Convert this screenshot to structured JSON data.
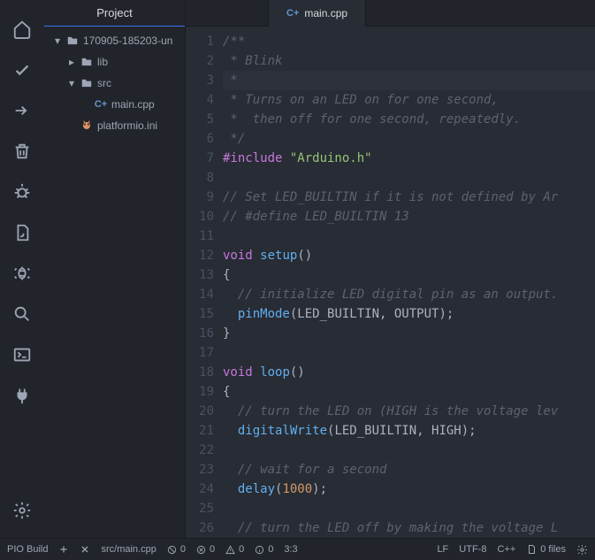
{
  "tree": {
    "title": "Project",
    "root": "170905-185203-un",
    "lib": "lib",
    "src": "src",
    "main": "main.cpp",
    "ini": "platformio.ini"
  },
  "tab": {
    "file": "main.cpp",
    "glyph": "C+"
  },
  "icons": {
    "cpp_glyph": "C+"
  },
  "code": [
    {
      "n": 1,
      "seg": [
        {
          "c": "com",
          "t": "/**"
        }
      ]
    },
    {
      "n": 2,
      "seg": [
        {
          "c": "com",
          "t": " * Blink"
        }
      ]
    },
    {
      "n": 3,
      "hl": true,
      "seg": [
        {
          "c": "com",
          "t": " *"
        }
      ]
    },
    {
      "n": 4,
      "seg": [
        {
          "c": "com",
          "t": " * Turns on an LED on for one second,"
        }
      ]
    },
    {
      "n": 5,
      "seg": [
        {
          "c": "com",
          "t": " *  then off for one second, repeatedly."
        }
      ]
    },
    {
      "n": 6,
      "seg": [
        {
          "c": "com",
          "t": " */"
        }
      ]
    },
    {
      "n": 7,
      "seg": [
        {
          "c": "pp",
          "t": "#include "
        },
        {
          "c": "str",
          "t": "\"Arduino.h\""
        }
      ]
    },
    {
      "n": 8,
      "seg": []
    },
    {
      "n": 9,
      "seg": [
        {
          "c": "com",
          "t": "// Set LED_BUILTIN if it is not defined by Ar"
        }
      ]
    },
    {
      "n": 10,
      "seg": [
        {
          "c": "com",
          "t": "// #define LED_BUILTIN 13"
        }
      ]
    },
    {
      "n": 11,
      "seg": []
    },
    {
      "n": 12,
      "seg": [
        {
          "c": "kw",
          "t": "void"
        },
        {
          "t": " "
        },
        {
          "c": "fn",
          "t": "setup"
        },
        {
          "t": "()"
        }
      ]
    },
    {
      "n": 13,
      "seg": [
        {
          "t": "{"
        }
      ]
    },
    {
      "n": 14,
      "seg": [
        {
          "t": "  "
        },
        {
          "c": "com",
          "t": "// initialize LED digital pin as an output."
        }
      ]
    },
    {
      "n": 15,
      "seg": [
        {
          "t": "  "
        },
        {
          "c": "fn",
          "t": "pinMode"
        },
        {
          "t": "(LED_BUILTIN, OUTPUT);"
        }
      ]
    },
    {
      "n": 16,
      "seg": [
        {
          "t": "}"
        }
      ]
    },
    {
      "n": 17,
      "seg": []
    },
    {
      "n": 18,
      "seg": [
        {
          "c": "kw",
          "t": "void"
        },
        {
          "t": " "
        },
        {
          "c": "fn",
          "t": "loop"
        },
        {
          "t": "()"
        }
      ]
    },
    {
      "n": 19,
      "seg": [
        {
          "t": "{"
        }
      ]
    },
    {
      "n": 20,
      "seg": [
        {
          "t": "  "
        },
        {
          "c": "com",
          "t": "// turn the LED on (HIGH is the voltage lev"
        }
      ]
    },
    {
      "n": 21,
      "seg": [
        {
          "t": "  "
        },
        {
          "c": "fn",
          "t": "digitalWrite"
        },
        {
          "t": "(LED_BUILTIN, HIGH);"
        }
      ]
    },
    {
      "n": 22,
      "seg": []
    },
    {
      "n": 23,
      "seg": [
        {
          "t": "  "
        },
        {
          "c": "com",
          "t": "// wait for a second"
        }
      ]
    },
    {
      "n": 24,
      "seg": [
        {
          "t": "  "
        },
        {
          "c": "fn",
          "t": "delay"
        },
        {
          "t": "("
        },
        {
          "c": "num",
          "t": "1000"
        },
        {
          "t": ");"
        }
      ]
    },
    {
      "n": 25,
      "seg": []
    },
    {
      "n": 26,
      "seg": [
        {
          "t": "  "
        },
        {
          "c": "com",
          "t": "// turn the LED off by making the voltage L"
        }
      ]
    }
  ],
  "status": {
    "build": "PIO Build",
    "path": "src/main.cpp",
    "deprec": "0",
    "err": "0",
    "warn": "0",
    "info": "0",
    "cursor": "3:3",
    "eol": "LF",
    "enc": "UTF-8",
    "lang": "C++",
    "files": "0 files"
  }
}
